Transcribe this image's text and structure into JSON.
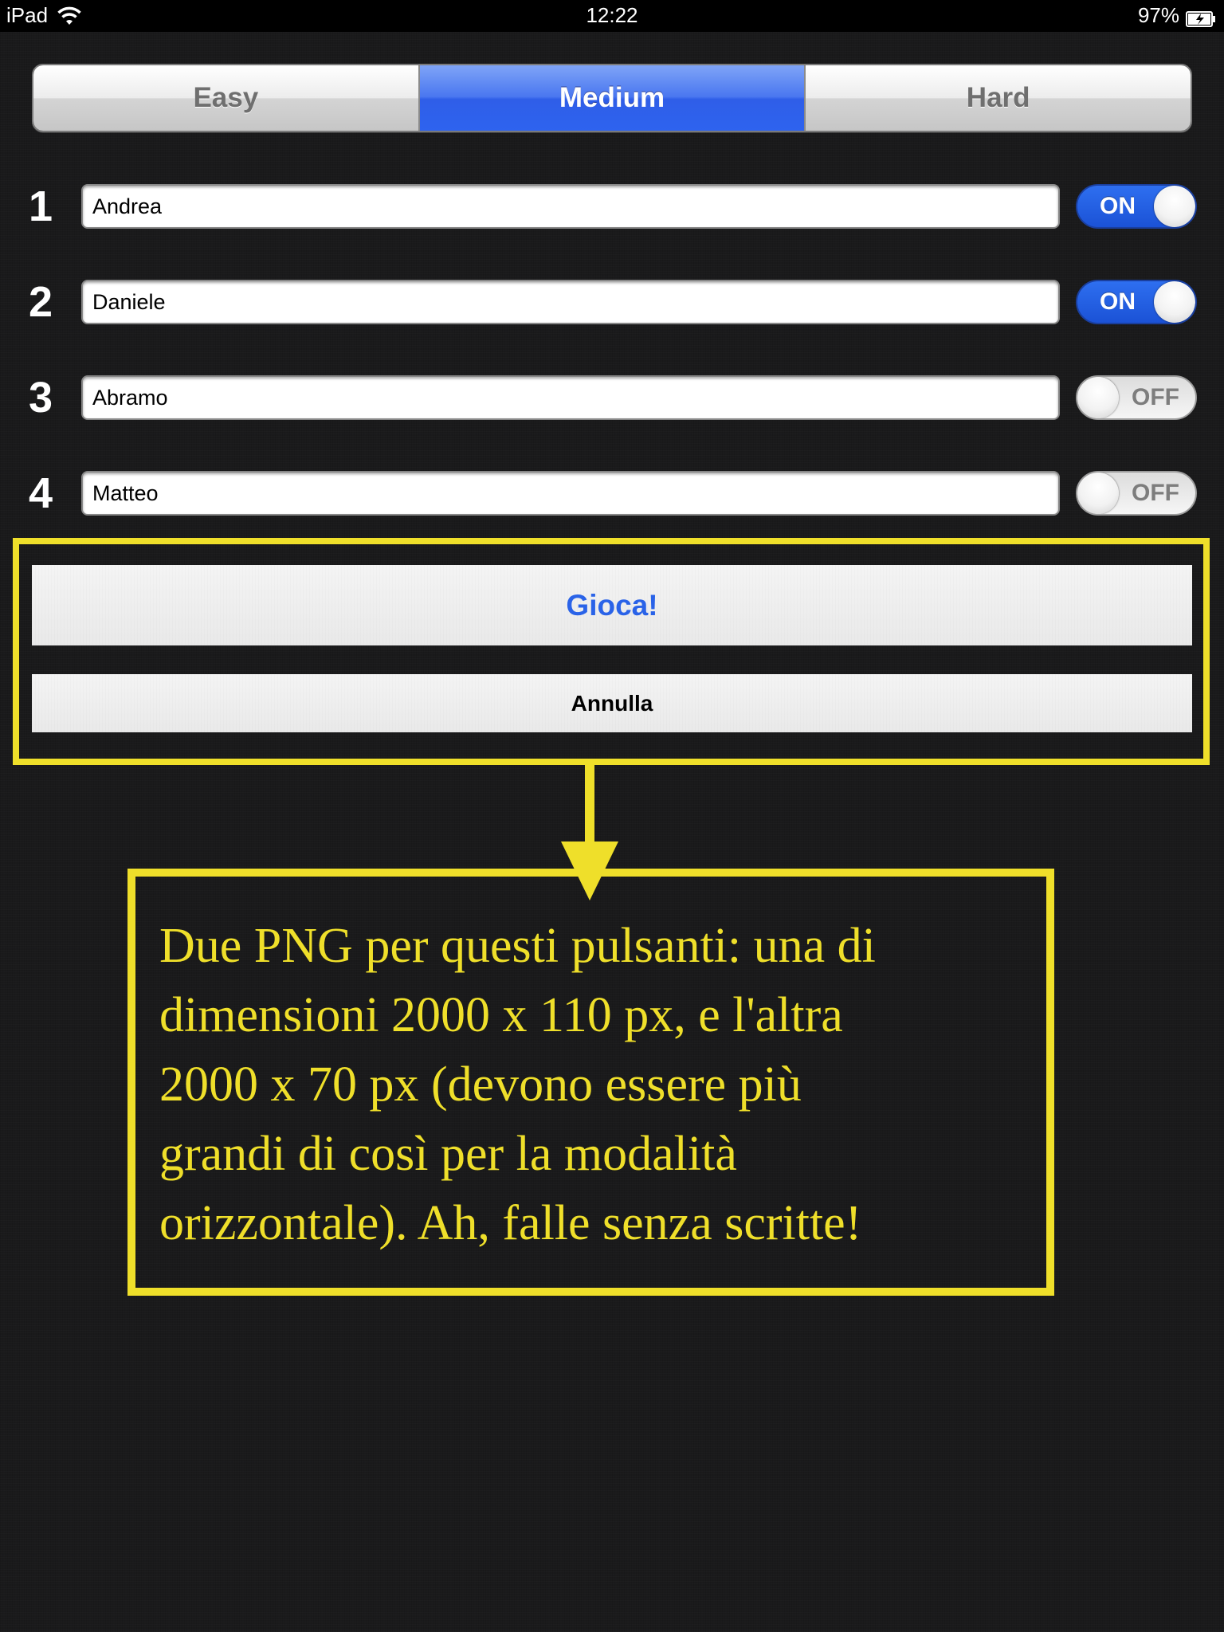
{
  "status_bar": {
    "device": "iPad",
    "time": "12:22",
    "battery": "97%"
  },
  "difficulty": {
    "segments": [
      "Easy",
      "Medium",
      "Hard"
    ],
    "selected": "Medium"
  },
  "players": [
    {
      "number": "1",
      "name": "Andrea",
      "toggle": "ON"
    },
    {
      "number": "2",
      "name": "Daniele",
      "toggle": "ON"
    },
    {
      "number": "3",
      "name": "Abramo",
      "toggle": "OFF"
    },
    {
      "number": "4",
      "name": "Matteo",
      "toggle": "OFF"
    }
  ],
  "actions": {
    "play_label": "Gioca!",
    "cancel_label": "Annulla"
  },
  "annotation": {
    "lines": [
      "Due PNG per questi pulsanti: una di",
      "dimensioni 2000 x 110 px, e l'altra",
      "2000 x 70 px (devono essere più",
      "grandi di così per la modalità",
      "orizzontale). Ah, falle senza scritte!"
    ]
  },
  "colors": {
    "background": "#1a1a1b",
    "accent_blue": "#2e63ef",
    "annotation_yellow": "#efdf2a",
    "play_text": "#2a63e8"
  }
}
